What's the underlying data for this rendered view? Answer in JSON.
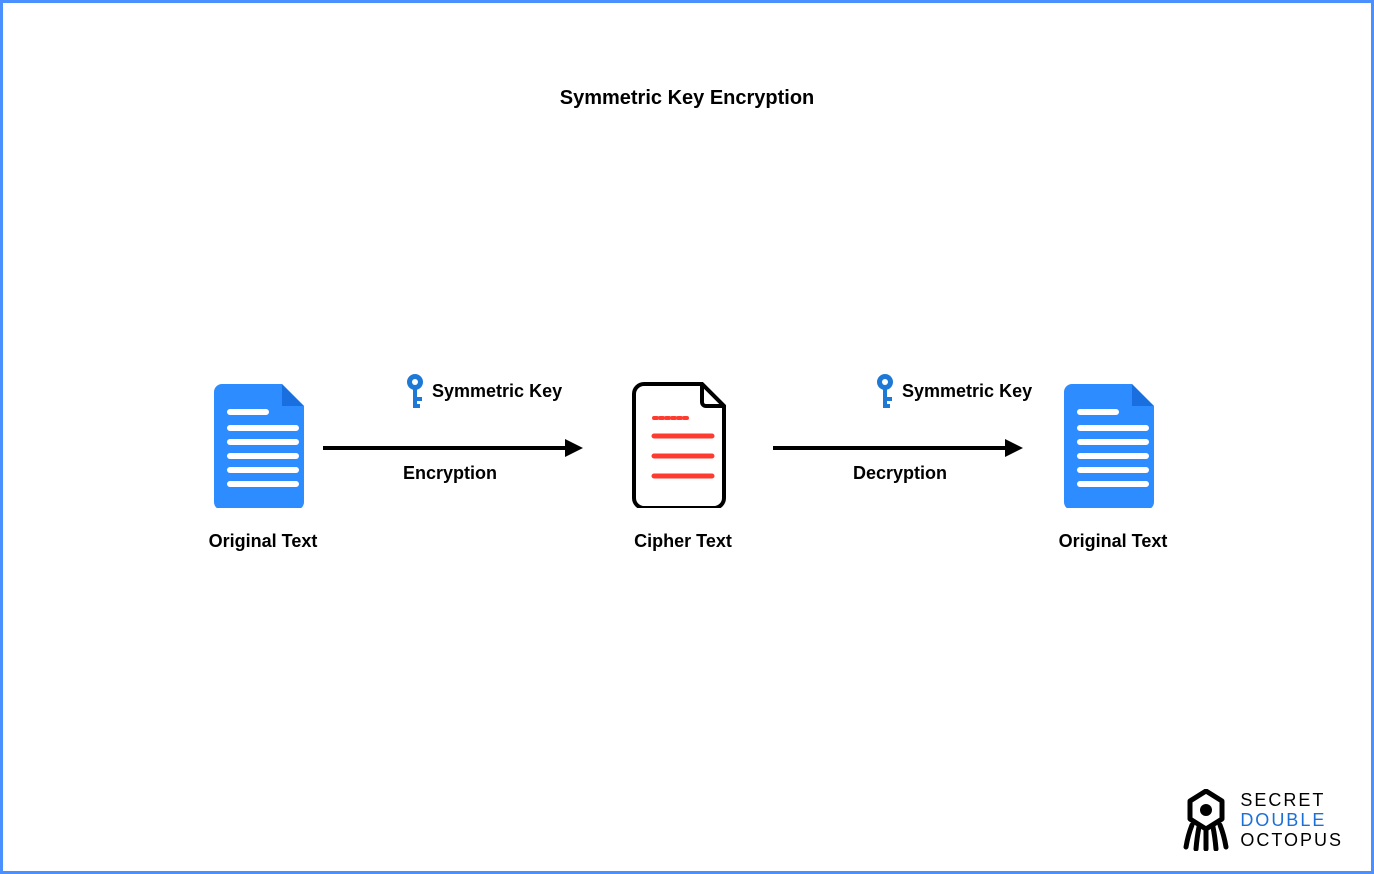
{
  "title": "Symmetric Key Encryption",
  "nodes": {
    "left": {
      "caption": "Original Text"
    },
    "center": {
      "caption": "Cipher Text"
    },
    "right": {
      "caption": "Original Text"
    }
  },
  "arrows": {
    "encrypt": {
      "key_label": "Symmetric Key",
      "action_label": "Encryption"
    },
    "decrypt": {
      "key_label": "Symmetric Key",
      "action_label": "Decryption"
    }
  },
  "logo": {
    "line1": "SECRET",
    "line2": "DOUBLE",
    "line3": "OCTOPUS"
  },
  "colors": {
    "doc_blue": "#2d8cff",
    "key_blue": "#1e79d6",
    "cipher_red": "#ff3b30",
    "frame": "#4a90ff"
  }
}
